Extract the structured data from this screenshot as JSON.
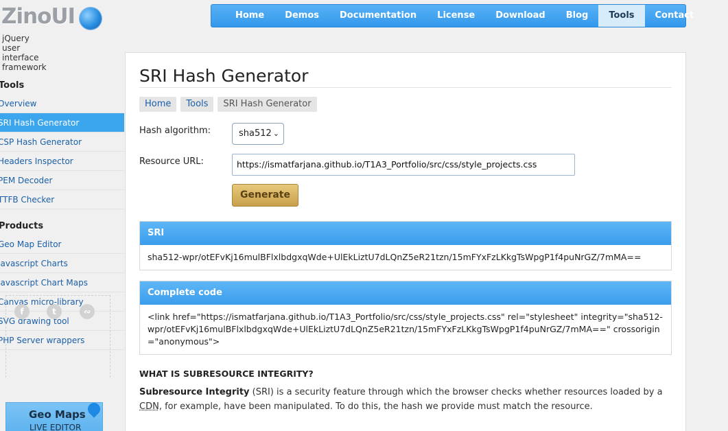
{
  "header": {
    "logo_text": "ZinoUI",
    "tagline": "jQuery user interface framework",
    "nav": [
      {
        "label": "Home",
        "active": false
      },
      {
        "label": "Demos",
        "active": false
      },
      {
        "label": "Documentation",
        "active": false
      },
      {
        "label": "License",
        "active": false
      },
      {
        "label": "Download",
        "active": false
      },
      {
        "label": "Blog",
        "active": false
      },
      {
        "label": "Tools",
        "active": true
      },
      {
        "label": "Contact",
        "active": false
      }
    ]
  },
  "sidebar": {
    "tools_heading": "Tools",
    "tools": [
      {
        "label": "Overview",
        "active": false
      },
      {
        "label": "SRI Hash Generator",
        "active": true
      },
      {
        "label": "CSP Hash Generator",
        "active": false
      },
      {
        "label": "Headers Inspector",
        "active": false
      },
      {
        "label": "PEM Decoder",
        "active": false
      },
      {
        "label": "TTFB Checker",
        "active": false
      }
    ],
    "products_heading": "Products",
    "products": [
      {
        "label": "Geo Map Editor"
      },
      {
        "label": "Javascript Charts"
      },
      {
        "label": "Javascript Chart Maps"
      },
      {
        "label": "Canvas micro-library"
      },
      {
        "label": "SVG drawing tool"
      },
      {
        "label": "PHP Server wrappers"
      }
    ],
    "social_icons": [
      "facebook-icon",
      "twitter-icon",
      "rss-icon"
    ],
    "promo": {
      "title": "Geo Maps",
      "subtitle": "LIVE EDITOR"
    }
  },
  "main": {
    "title": "SRI Hash Generator",
    "breadcrumbs": [
      {
        "label": "Home"
      },
      {
        "label": "Tools"
      },
      {
        "label": "SRI Hash Generator"
      }
    ],
    "hash_label": "Hash algorithm:",
    "hash_value": "sha512",
    "url_label": "Resource URL:",
    "url_value": "https://ismatfarjana.github.io/T1A3_Portfolio/src/css/style_projects.css",
    "generate_label": "Generate",
    "sri_heading": "SRI",
    "sri_value": "sha512-wpr/otEFvKj16mulBFlxlbdgxqWde+UlEkLiztU7dLQnZ5eR21tzn/15mFYxFzLKkgTsWpgP1f4puNrGZ/7mMA==",
    "code_heading": "Complete code",
    "code_value": "<link href=\"https://ismatfarjana.github.io/T1A3_Portfolio/src/css/style_projects.css\" rel=\"stylesheet\" integrity=\"sha512-wpr/otEFvKj16mulBFlxlbdgxqWde+UlEkLiztU7dLQnZ5eR21tzn/15mFYxFzLKkgTsWpgP1f4puNrGZ/7mMA==\" crossorigin=\"anonymous\">",
    "what_heading": "WHAT IS SUBRESOURCE INTEGRITY?",
    "desc_bold": "Subresource Integrity",
    "desc_part1": " (SRI) is a security feature through which the browser checks whether resources loaded by a ",
    "desc_cdn": "CDN",
    "desc_part2": ", for example, have been manipulated. To do this, the hash we provide must match the resource."
  }
}
